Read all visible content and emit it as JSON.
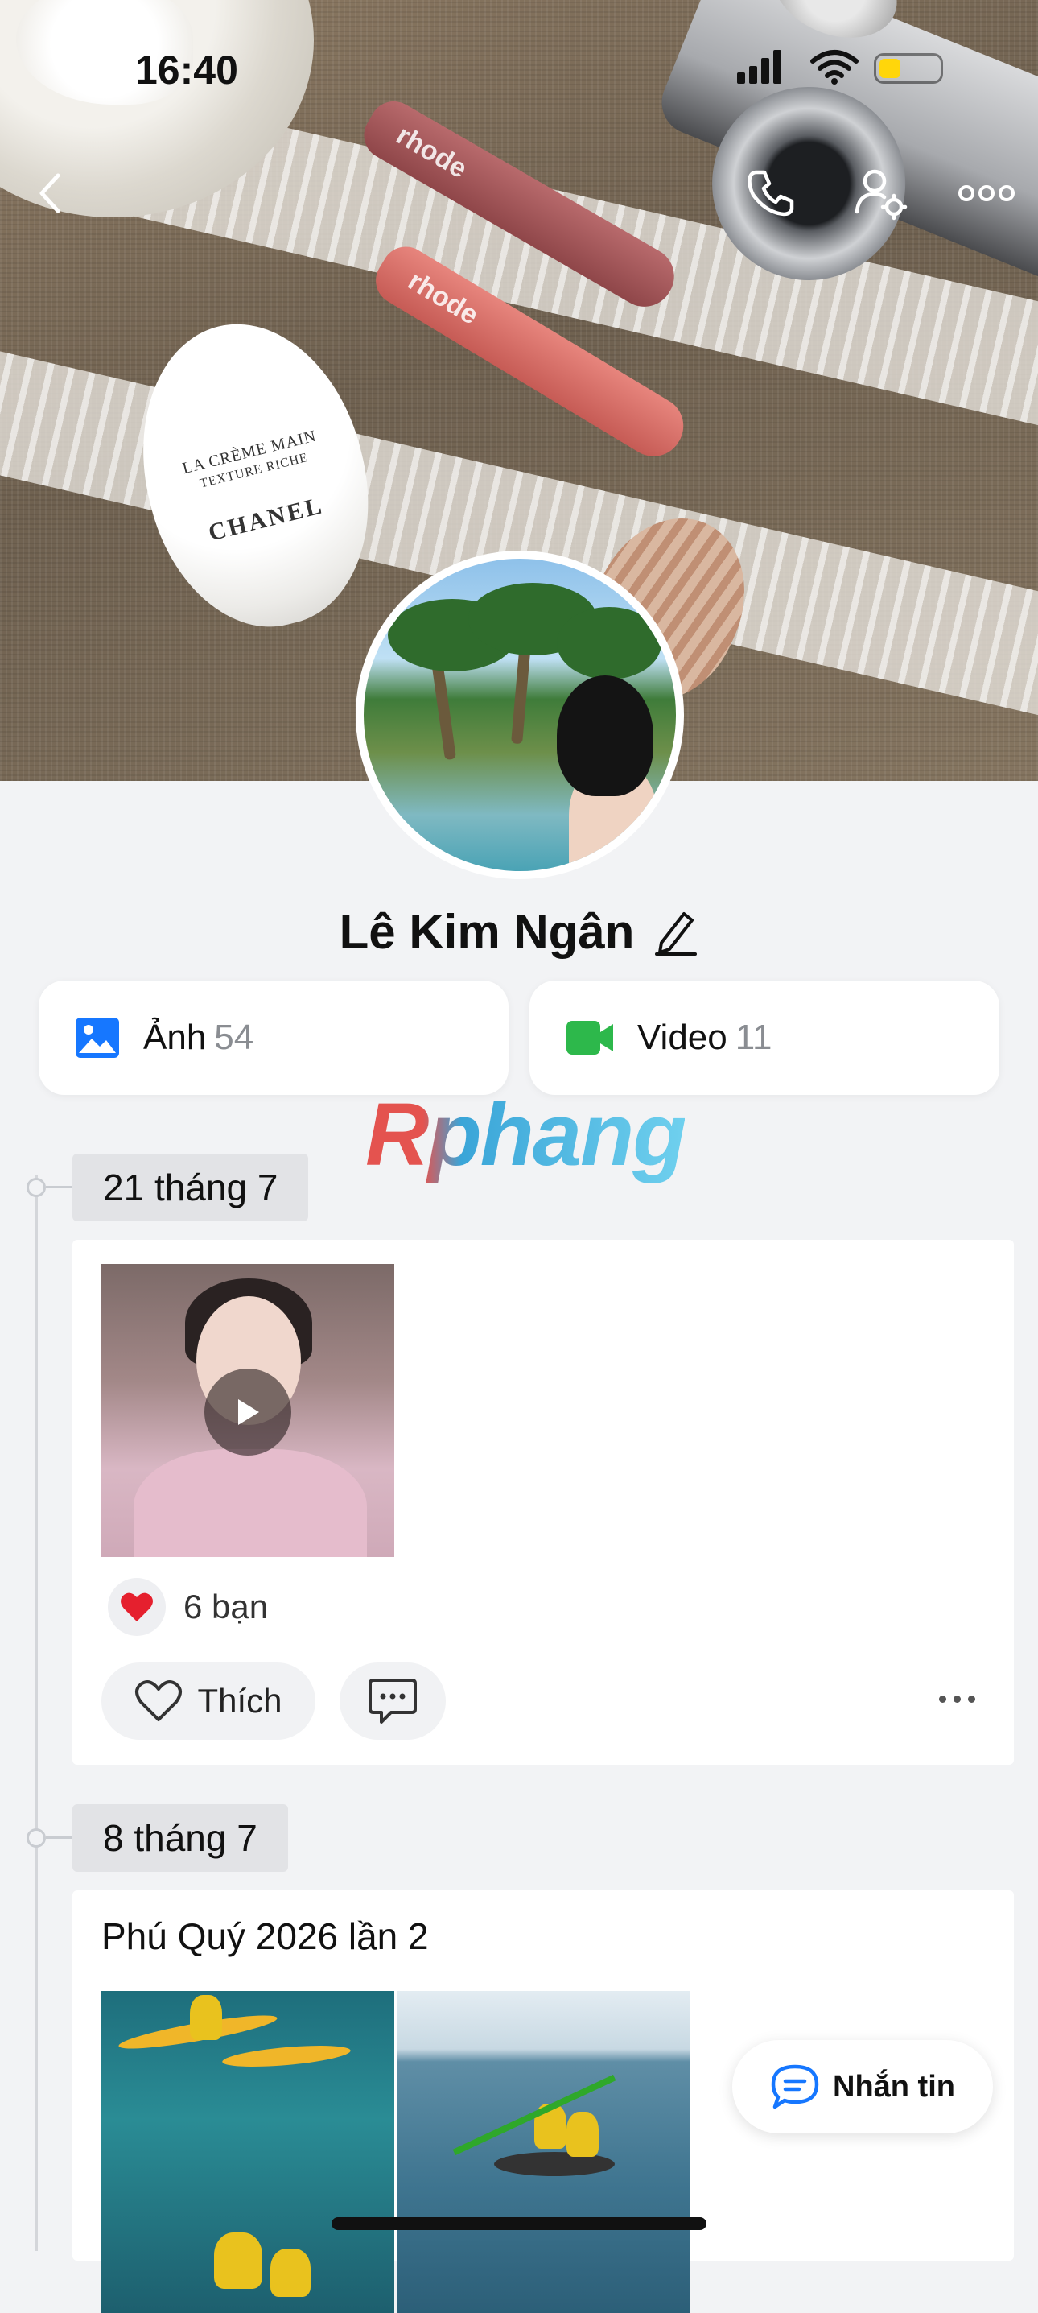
{
  "status_bar": {
    "time": "16:40"
  },
  "cover": {
    "lipstick_text": [
      "rhode",
      "rhode"
    ],
    "egg_line1": "LA CRÈME MAIN",
    "egg_line2": "TEXTURE RICHE",
    "egg_brand": "CHANEL"
  },
  "profile": {
    "name": "Lê Kim Ngân"
  },
  "media": {
    "photos": {
      "label": "Ảnh",
      "count": "54",
      "icon": "image-icon",
      "color": "#1677ff"
    },
    "videos": {
      "label": "Video",
      "count": "11",
      "icon": "video-camera-icon",
      "color": "#2db84b"
    }
  },
  "watermark": "Rphang",
  "posts": [
    {
      "date": "21 tháng 7",
      "type": "video",
      "reactions": "6 bạn",
      "like_label": "Thích"
    },
    {
      "date": "8 tháng 7",
      "title": "Phú Quý 2026 lần 2",
      "type": "photos"
    }
  ],
  "message_button": {
    "label": "Nhắn tin"
  },
  "colors": {
    "accent": "#1677ff",
    "heart": "#e5202e",
    "background": "#f2f3f5"
  }
}
